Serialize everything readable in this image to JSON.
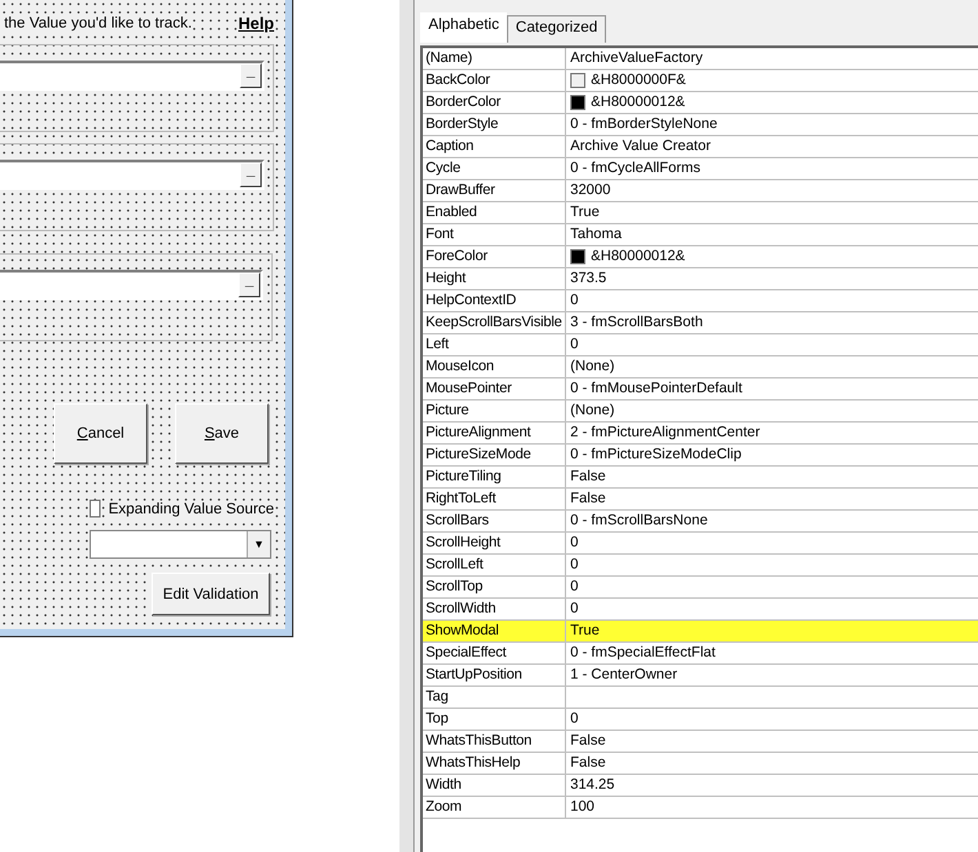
{
  "form": {
    "instruction": "the Value you'd like to track.",
    "help_link": "Help",
    "fields": [
      {
        "button": "_"
      },
      {
        "button": "_"
      },
      {
        "button": "_"
      }
    ],
    "buttons": [
      {
        "mnemonic": "C",
        "rest": "ancel"
      },
      {
        "mnemonic": "S",
        "rest": "ave"
      }
    ],
    "checkbox": {
      "label": "Expanding Value Source",
      "checked": false
    },
    "combo": {
      "button": "▼"
    },
    "edit_button": "Edit Validation"
  },
  "properties": {
    "tabs": [
      {
        "label": "Alphabetic",
        "selected": true
      },
      {
        "label": "Categorized",
        "selected": false
      }
    ],
    "rows": [
      {
        "name": "(Name)",
        "value": "ArchiveValueFactory",
        "highlighted": false
      },
      {
        "name": "BackColor",
        "value": "&H8000000F&",
        "color": "#f0f0f0",
        "highlighted": false
      },
      {
        "name": "BorderColor",
        "value": "&H80000012&",
        "color": "#000000",
        "highlighted": false
      },
      {
        "name": "BorderStyle",
        "value": "0 - fmBorderStyleNone",
        "highlighted": false
      },
      {
        "name": "Caption",
        "value": "Archive Value Creator",
        "highlighted": false
      },
      {
        "name": "Cycle",
        "value": "0 - fmCycleAllForms",
        "highlighted": false
      },
      {
        "name": "DrawBuffer",
        "value": "32000",
        "highlighted": false
      },
      {
        "name": "Enabled",
        "value": "True",
        "highlighted": false
      },
      {
        "name": "Font",
        "value": "Tahoma",
        "highlighted": false
      },
      {
        "name": "ForeColor",
        "value": "&H80000012&",
        "color": "#000000",
        "highlighted": false
      },
      {
        "name": "Height",
        "value": "373.5",
        "highlighted": false
      },
      {
        "name": "HelpContextID",
        "value": "0",
        "highlighted": false
      },
      {
        "name": "KeepScrollBarsVisible",
        "value": "3 - fmScrollBarsBoth",
        "highlighted": false
      },
      {
        "name": "Left",
        "value": "0",
        "highlighted": false
      },
      {
        "name": "MouseIcon",
        "value": "(None)",
        "highlighted": false
      },
      {
        "name": "MousePointer",
        "value": "0 - fmMousePointerDefault",
        "highlighted": false
      },
      {
        "name": "Picture",
        "value": "(None)",
        "highlighted": false
      },
      {
        "name": "PictureAlignment",
        "value": "2 - fmPictureAlignmentCenter",
        "highlighted": false
      },
      {
        "name": "PictureSizeMode",
        "value": "0 - fmPictureSizeModeClip",
        "highlighted": false
      },
      {
        "name": "PictureTiling",
        "value": "False",
        "highlighted": false
      },
      {
        "name": "RightToLeft",
        "value": "False",
        "highlighted": false
      },
      {
        "name": "ScrollBars",
        "value": "0 - fmScrollBarsNone",
        "highlighted": false
      },
      {
        "name": "ScrollHeight",
        "value": "0",
        "highlighted": false
      },
      {
        "name": "ScrollLeft",
        "value": "0",
        "highlighted": false
      },
      {
        "name": "ScrollTop",
        "value": "0",
        "highlighted": false
      },
      {
        "name": "ScrollWidth",
        "value": "0",
        "highlighted": false
      },
      {
        "name": "ShowModal",
        "value": "True",
        "highlighted": true
      },
      {
        "name": "SpecialEffect",
        "value": "0 - fmSpecialEffectFlat",
        "highlighted": false
      },
      {
        "name": "StartUpPosition",
        "value": "1 - CenterOwner",
        "highlighted": false
      },
      {
        "name": "Tag",
        "highlighted": false
      },
      {
        "name": "Top",
        "value": "0",
        "highlighted": false
      },
      {
        "name": "WhatsThisButton",
        "value": "False",
        "highlighted": false
      },
      {
        "name": "WhatsThisHelp",
        "value": "False",
        "highlighted": false
      },
      {
        "name": "Width",
        "value": "314.25",
        "highlighted": false
      },
      {
        "name": "Zoom",
        "value": "100",
        "highlighted": false
      }
    ]
  }
}
